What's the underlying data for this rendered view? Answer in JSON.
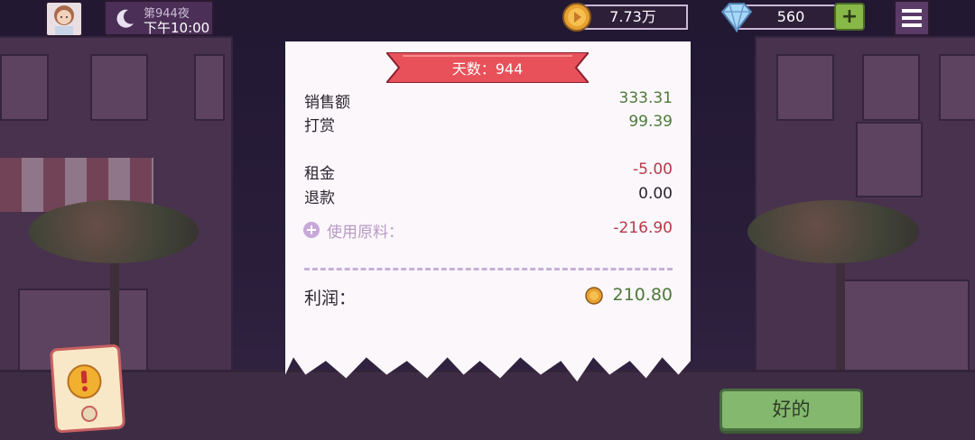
{
  "hud": {
    "day_night_label": "第944夜",
    "time_label": "下午10:00",
    "coins": "7.73万",
    "gems": "560",
    "add_symbol": "+"
  },
  "receipt": {
    "title": "天数：944",
    "rows": [
      {
        "label": "销售额",
        "value": "333.31",
        "tone": "green"
      },
      {
        "label": "打赏",
        "value": "99.39",
        "tone": "green"
      },
      {
        "label": "租金",
        "value": "-5.00",
        "tone": "red"
      },
      {
        "label": "退款",
        "value": "0.00",
        "tone": "dark"
      }
    ],
    "materials_label": "使用原料：",
    "materials_value": "-216.90",
    "profit_label": "利润：",
    "profit_value": "210.80"
  },
  "buttons": {
    "ok_label": "好的"
  },
  "colors": {
    "accent_green": "#84b86e",
    "positive": "#4e7a3a",
    "negative": "#b83a4a",
    "ribbon": "#e8505a"
  }
}
